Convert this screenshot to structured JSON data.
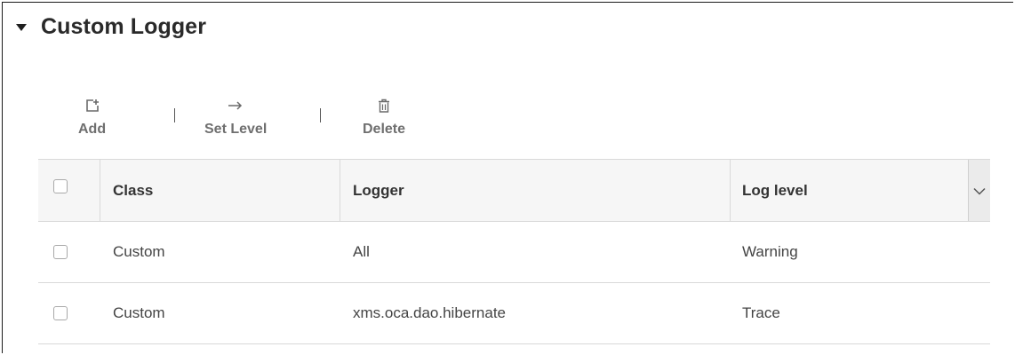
{
  "section": {
    "title": "Custom Logger"
  },
  "toolbar": {
    "add_label": "Add",
    "set_level_label": "Set Level",
    "delete_label": "Delete"
  },
  "table": {
    "columns": [
      "Class",
      "Logger",
      "Log level"
    ],
    "rows": [
      {
        "class": "Custom",
        "logger": "All",
        "level": "Warning"
      },
      {
        "class": "Custom",
        "logger": "xms.oca.dao.hibernate",
        "level": "Trace"
      }
    ]
  },
  "colors": {
    "text": "#333333",
    "muted": "#6f6f6f",
    "header_bg": "#f6f6f6",
    "border": "#d9d9d9"
  }
}
